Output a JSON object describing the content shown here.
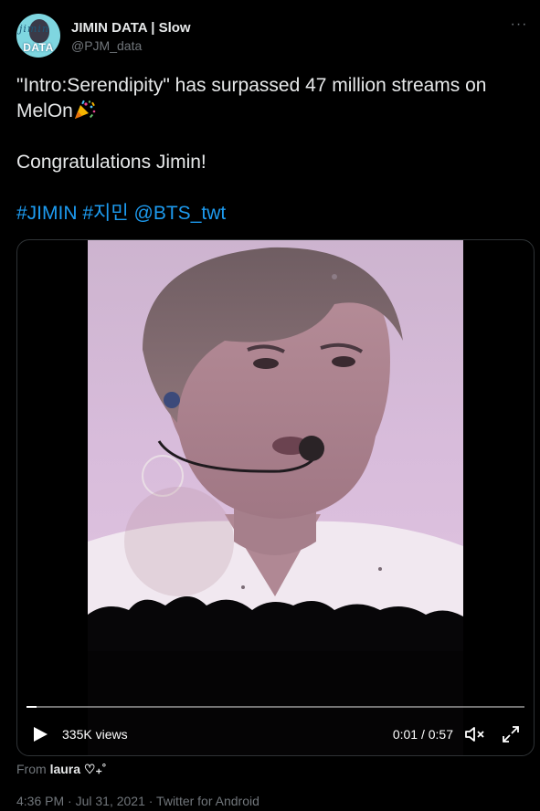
{
  "author": {
    "display_name": "JIMIN DATA | Slow",
    "username": "@PJM_data",
    "avatar_text": "DATA",
    "avatar_script": "jimin"
  },
  "tweet": {
    "line1": "\"Intro:Serendipity\" has surpassed 47 million streams on MelOn",
    "line2": "Congratulations Jimin!",
    "hashtag_jimin": "#JIMIN",
    "hashtag_korean": "#지민",
    "mention": "@BTS_twt",
    "emoji_icon": "party-popper-icon"
  },
  "video": {
    "views": "335K views",
    "time": "0:01 / 0:57",
    "progress": 0.02,
    "from_label": "From",
    "from_user": "laura ♡₊˚"
  },
  "meta": {
    "timestamp": "4:36 PM · Jul 31, 2021 · Twitter for Android"
  },
  "colors": {
    "background": "#000000",
    "text": "#e7e9ea",
    "secondary": "#71767b",
    "link": "#1d9bf0",
    "border": "#2f3336"
  }
}
